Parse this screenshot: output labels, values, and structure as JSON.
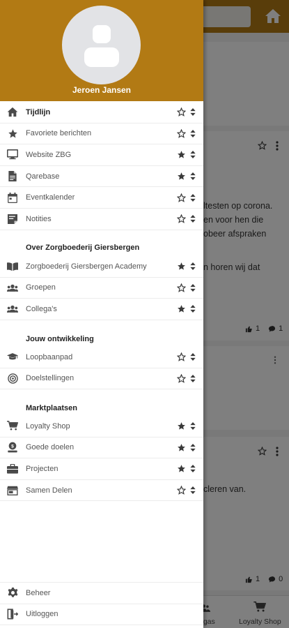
{
  "user": {
    "name": "Jeroen Jansen"
  },
  "background": {
    "text_lines": [
      "ltesten op corona.",
      "en voor hen die",
      "obeer afspraken",
      "n horen wij dat",
      "cleren van."
    ],
    "post1_stats": {
      "likes": "1",
      "comments": "1"
    },
    "post2_stats": {
      "likes": "1",
      "comments": "0"
    },
    "bottom_nav": {
      "partial_label": "egas",
      "loyalty_label": "Loyalty Shop"
    }
  },
  "menu_main": [
    {
      "label": "Tijdlijn",
      "icon": "home-icon",
      "favorite": false,
      "bold": true
    },
    {
      "label": "Favoriete berichten",
      "icon": "star-icon",
      "favorite": false
    },
    {
      "label": "Website ZBG",
      "icon": "monitor-icon",
      "favorite": true
    },
    {
      "label": "Qarebase",
      "icon": "document-icon",
      "favorite": true
    },
    {
      "label": "Eventkalender",
      "icon": "calendar-icon",
      "favorite": false
    },
    {
      "label": "Notities",
      "icon": "note-icon",
      "favorite": false
    }
  ],
  "section_about": {
    "title": "Over Zorgboederij Giersbergen",
    "items": [
      {
        "label": "Zorgboederij Giersbergen Academy",
        "icon": "book-icon",
        "favorite": true
      },
      {
        "label": "Groepen",
        "icon": "users-icon",
        "favorite": false
      },
      {
        "label": "Collega's",
        "icon": "users-icon",
        "favorite": true
      }
    ]
  },
  "section_dev": {
    "title": "Jouw ontwikkeling",
    "items": [
      {
        "label": "Loopbaanpad",
        "icon": "graduation-cap-icon",
        "favorite": false
      },
      {
        "label": "Doelstellingen",
        "icon": "target-icon",
        "favorite": false
      }
    ]
  },
  "section_market": {
    "title": "Marktplaatsen",
    "items": [
      {
        "label": "Loyalty Shop",
        "icon": "cart-icon",
        "favorite": true
      },
      {
        "label": "Goede doelen",
        "icon": "donate-icon",
        "favorite": true
      },
      {
        "label": "Projecten",
        "icon": "briefcase-icon",
        "favorite": true
      },
      {
        "label": "Samen Delen",
        "icon": "store-icon",
        "favorite": false
      }
    ]
  },
  "footer": [
    {
      "label": "Beheer",
      "icon": "gear-icon"
    },
    {
      "label": "Uitloggen",
      "icon": "logout-icon"
    }
  ],
  "colors": {
    "brand": "#b27a14",
    "icon": "#4a4a4a"
  }
}
